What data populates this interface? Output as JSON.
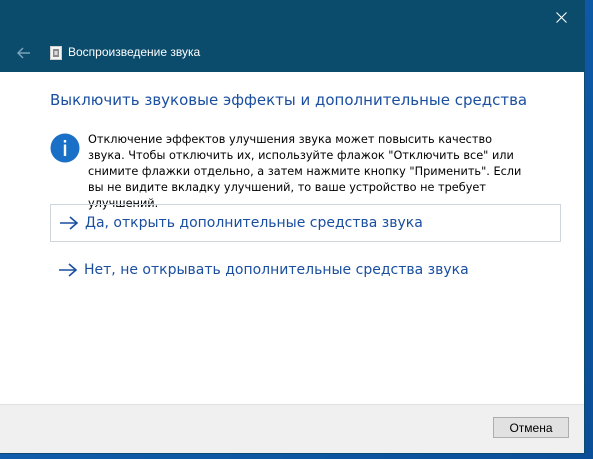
{
  "window": {
    "title": "Воспроизведение звука",
    "close_icon": "close-icon",
    "back_icon": "back-arrow-icon",
    "app_icon": "speaker-app-icon"
  },
  "content": {
    "heading": "Выключить звуковые эффекты и дополнительные средства",
    "info_icon": "info-icon",
    "info_text": "Отключение эффектов улучшения звука может повысить качество звука. Чтобы отключить их, используйте флажок \"Отключить все\" или снимите флажки отдельно, а затем нажмите кнопку \"Применить\". Если вы не видите вкладку улучшений, то ваше устройство не требует улучшений.",
    "links": [
      {
        "label": "Да, открыть дополнительные средства звука",
        "icon": "arrow-right-icon"
      },
      {
        "label": "Нет, не открывать дополнительные средства звука",
        "icon": "arrow-right-icon"
      }
    ]
  },
  "footer": {
    "cancel_label": "Отмена"
  },
  "colors": {
    "titlebar": "#0b4b6c",
    "accent": "#1a4fa0",
    "info_icon_bg": "#1a6fc7",
    "footer_bg": "#f0f0f0"
  }
}
